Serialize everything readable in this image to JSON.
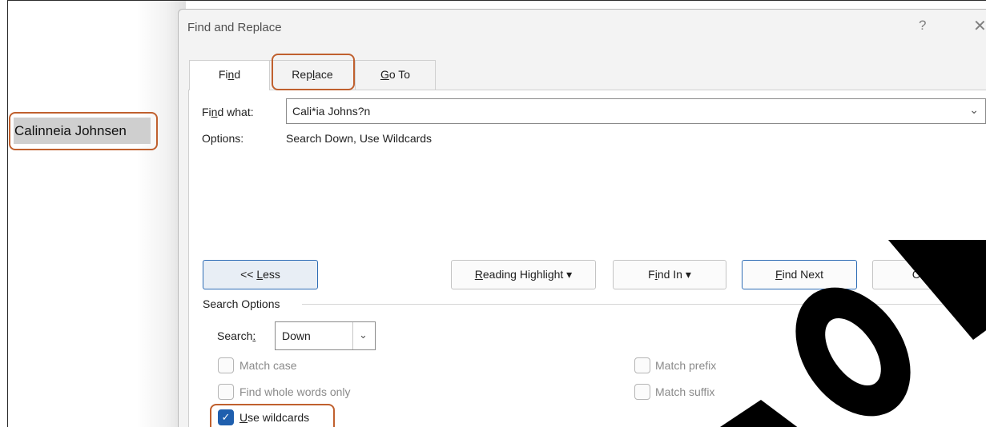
{
  "document": {
    "text": "Calinneia Johnsen"
  },
  "dialog": {
    "title": "Find and Replace",
    "help_glyph": "?",
    "close_glyph": "✕",
    "tabs": [
      {
        "label_pre": "Fi",
        "label_ul": "n",
        "label_post": "d"
      },
      {
        "label_pre": "Rep",
        "label_ul": "l",
        "label_post": "ace"
      },
      {
        "label_pre": "",
        "label_ul": "G",
        "label_post": "o To"
      }
    ],
    "find_what": {
      "label_pre": "Fi",
      "label_ul": "n",
      "label_post": "d what:",
      "value": "Cali*ia Johns?n",
      "chevron": "⌄"
    },
    "options": {
      "label": "Options:",
      "value": "Search Down, Use Wildcards"
    },
    "buttons": {
      "less_pre": "<< ",
      "less_ul": "L",
      "less_post": "ess",
      "reading_ul": "R",
      "reading_post": "eading Highlight ▾",
      "findin_pre": "F",
      "findin_ul": "i",
      "findin_post": "nd In ▾",
      "findnext_ul": "F",
      "findnext_post": "ind Next",
      "cancel": "Cancel"
    },
    "search_options": {
      "heading": "Search Options",
      "search_label_pre": "Search",
      "search_label_ul": ":",
      "search_value": "Down",
      "checkboxes": [
        {
          "label": "Match case",
          "checked": false
        },
        {
          "label": "Find whole words only",
          "checked": false
        },
        {
          "label_ul": "U",
          "label_post": "se wildcards",
          "checked": true
        },
        {
          "label": "Match prefix",
          "checked": false
        },
        {
          "label": "Match suffix",
          "checked": false
        }
      ],
      "check_glyph": "✓"
    }
  },
  "colors": {
    "callout": "#c0602e",
    "accent": "#2f6db5",
    "checkbox": "#1f5fae",
    "watermark": "#000000"
  }
}
